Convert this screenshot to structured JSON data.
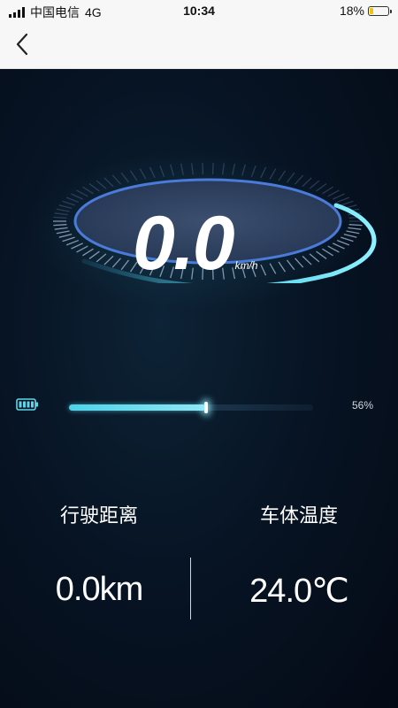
{
  "status_bar": {
    "carrier": "中国电信",
    "network": "4G",
    "time": "10:34",
    "battery_percent_text": "18%",
    "battery_level": 0.18,
    "battery_color": "#f5c400"
  },
  "nav": {
    "back_icon": "chevron-left-icon"
  },
  "speedometer": {
    "value": "0.0",
    "unit": "km/h",
    "accent_color": "#5ad8ea"
  },
  "battery_level": {
    "icon": "battery-icon",
    "percent": 56,
    "percent_text": "56%"
  },
  "stats": {
    "distance_label": "行驶距离",
    "distance_value": "0.0km",
    "temperature_label": "车体温度",
    "temperature_value": "24.0℃"
  }
}
